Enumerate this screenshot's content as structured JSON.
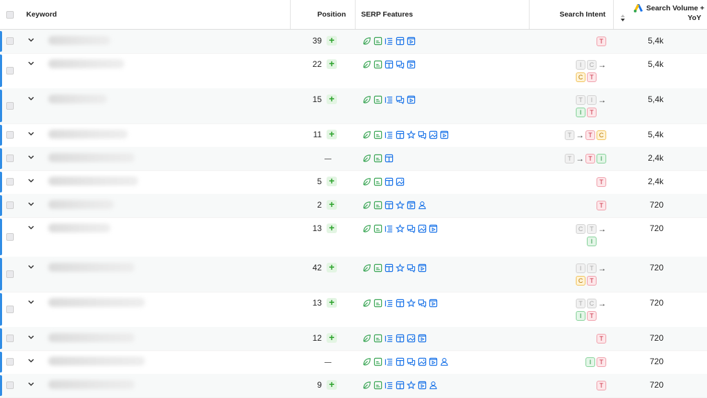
{
  "header": {
    "keyword": "Keyword",
    "position": "Position",
    "serp": "SERP Features",
    "intent": "Search Intent",
    "volume_line1": "Search Volume +",
    "volume_line2": "YoY"
  },
  "colors": {
    "accent": "#2f8ce5",
    "feature_green": "#3aa655",
    "feature_blue": "#1a73e8"
  },
  "rows": [
    {
      "position": "39",
      "ranked": true,
      "features": [
        "leaf",
        "snip",
        "list",
        "news",
        "video"
      ],
      "intent_rows": [
        [
          "T"
        ]
      ],
      "intent_gray": [],
      "volume": "5,4k"
    },
    {
      "position": "22",
      "ranked": true,
      "features": [
        "leaf",
        "snip",
        "news",
        "chat",
        "video"
      ],
      "intent_rows": [
        [
          "I",
          "C",
          "→"
        ],
        [
          "C",
          "T"
        ]
      ],
      "volume": "5,4k"
    },
    {
      "position": "15",
      "ranked": true,
      "features": [
        "leaf",
        "snip",
        "list",
        "chat",
        "video"
      ],
      "intent_rows": [
        [
          "T",
          "I",
          "→"
        ],
        [
          "I",
          "T"
        ]
      ],
      "volume": "5,4k"
    },
    {
      "position": "11",
      "ranked": true,
      "features": [
        "leaf",
        "snip",
        "list",
        "news",
        "star",
        "chat",
        "image",
        "video"
      ],
      "intent_rows": [
        [
          "T",
          "→",
          "T",
          "C"
        ]
      ],
      "volume": "5,4k"
    },
    {
      "position": "—",
      "ranked": false,
      "features": [
        "leaf",
        "snip",
        "news"
      ],
      "intent_rows": [
        [
          "T",
          "→",
          "T",
          "I"
        ]
      ],
      "volume": "2,4k"
    },
    {
      "position": "5",
      "ranked": true,
      "features": [
        "leaf",
        "snip",
        "news",
        "image"
      ],
      "intent_rows": [
        [
          "T"
        ]
      ],
      "volume": "2,4k"
    },
    {
      "position": "2",
      "ranked": true,
      "features": [
        "leaf",
        "snip",
        "news",
        "star",
        "video",
        "person"
      ],
      "intent_rows": [
        [
          "T"
        ]
      ],
      "volume": "720"
    },
    {
      "position": "13",
      "ranked": true,
      "features": [
        "leaf",
        "snip",
        "list",
        "star",
        "chat",
        "image",
        "video"
      ],
      "intent_rows": [
        [
          "C",
          "T",
          "→"
        ],
        [
          "I"
        ]
      ],
      "volume": "720"
    },
    {
      "position": "42",
      "ranked": true,
      "features": [
        "leaf",
        "snip",
        "news",
        "star",
        "chat",
        "video"
      ],
      "intent_rows": [
        [
          "I",
          "T",
          "→"
        ],
        [
          "C",
          "T"
        ]
      ],
      "volume": "720"
    },
    {
      "position": "13",
      "ranked": true,
      "features": [
        "leaf",
        "snip",
        "list",
        "news",
        "star",
        "chat",
        "video"
      ],
      "intent_rows": [
        [
          "T",
          "C",
          "→"
        ],
        [
          "I",
          "T"
        ]
      ],
      "volume": "720"
    },
    {
      "position": "12",
      "ranked": true,
      "features": [
        "leaf",
        "snip",
        "list",
        "news",
        "image",
        "video"
      ],
      "intent_rows": [
        [
          "T"
        ]
      ],
      "volume": "720"
    },
    {
      "position": "—",
      "ranked": false,
      "features": [
        "leaf",
        "snip",
        "list",
        "news",
        "chat",
        "image",
        "video",
        "person"
      ],
      "intent_rows": [
        [
          "I",
          "T"
        ]
      ],
      "volume": "720"
    },
    {
      "position": "9",
      "ranked": true,
      "features": [
        "leaf",
        "snip",
        "list",
        "news",
        "star",
        "video",
        "person"
      ],
      "intent_rows": [
        [
          "T"
        ]
      ],
      "volume": "720"
    }
  ]
}
